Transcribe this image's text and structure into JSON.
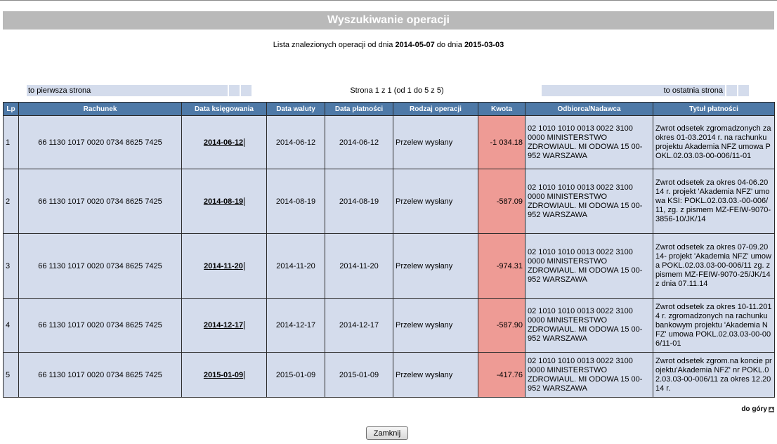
{
  "title": "Wyszukiwanie operacji",
  "subtitle": {
    "prefix": "Lista znalezionych operacji od dnia",
    "date_from": "2014-05-07",
    "middle": "do dnia",
    "date_to": "2015-03-03"
  },
  "pager": {
    "first": "to pierwsza strona",
    "info": "Strona 1 z 1 (od 1 do 5 z 5)",
    "last": "to ostatnia strona"
  },
  "table": {
    "headers": [
      "Lp",
      "Rachunek",
      "Data księgowania",
      "Data waluty",
      "Data płatności",
      "Rodzaj operacji",
      "Kwota",
      "Odbiorca/Nadawca",
      "Tytuł płatności"
    ],
    "rows": [
      {
        "lp": "1",
        "rachunek": "66 1130 1017 0020 0734 8625 7425",
        "data_ksiegowania": "2014-06-12",
        "data_waluty": "2014-06-12",
        "data_platnosci": "2014-06-12",
        "rodzaj": "Przelew wysłany",
        "kwota": "-1 034.18",
        "odbiorca": "02 1010 1010 0013 0022 3100 0000 MINISTERSTWO ZDROWIAUL. MI ODOWA 15 00-952 WARSZAWA",
        "tytul": "Zwrot odsetek zgromadzonych za okres 01-03.2014 r. na rachunku projektu Akademia NFZ umowa POKL.02.03.03-00-006/11-01"
      },
      {
        "lp": "2",
        "rachunek": "66 1130 1017 0020 0734 8625 7425",
        "data_ksiegowania": "2014-08-19",
        "data_waluty": "2014-08-19",
        "data_platnosci": "2014-08-19",
        "rodzaj": "Przelew wysłany",
        "kwota": "-587.09",
        "odbiorca": "02 1010 1010 0013 0022 3100 0000 MINISTERSTWO ZDROWIAUL. MI ODOWA 15 00-952 WARSZAWA",
        "tytul": "Zwrot odsetek za okres 04-06.2014 r. projekt 'Akademia NFZ' umowa KSI: POKL.02.03.03.-00-006/11, zg. z pismem MZ-FEIW-9070-3856-10/JK/14"
      },
      {
        "lp": "3",
        "rachunek": "66 1130 1017 0020 0734 8625 7425",
        "data_ksiegowania": "2014-11-20",
        "data_waluty": "2014-11-20",
        "data_platnosci": "2014-11-20",
        "rodzaj": "Przelew wysłany",
        "kwota": "-974.31",
        "odbiorca": "02 1010 1010 0013 0022 3100 0000 MINISTERSTWO ZDROWIAUL. MI ODOWA 15 00-952 WARSZAWA",
        "tytul": "Zwrot odsetek za okres 07-09.2014- projekt 'Akademia NFZ' umowa POKL.02.03.03-00-006/11 zg. z pismem MZ-FEIW-9070-25/JK/14 z dnia 07.11.14"
      },
      {
        "lp": "4",
        "rachunek": "66 1130 1017 0020 0734 8625 7425",
        "data_ksiegowania": "2014-12-17",
        "data_waluty": "2014-12-17",
        "data_platnosci": "2014-12-17",
        "rodzaj": "Przelew wysłany",
        "kwota": "-587.90",
        "odbiorca": "02 1010 1010 0013 0022 3100 0000 MINISTERSTWO ZDROWIAUL. MI ODOWA 15 00-952 WARSZAWA",
        "tytul": "Zwrot odsetek za okres 10-11.2014 r. zgromadzonych na rachunku bankowym projektu 'Akademia NFZ' umowa POKL.02.03.03-00-006/11-01"
      },
      {
        "lp": "5",
        "rachunek": "66 1130 1017 0020 0734 8625 7425",
        "data_ksiegowania": "2015-01-09",
        "data_waluty": "2015-01-09",
        "data_platnosci": "2015-01-09",
        "rodzaj": "Przelew wysłany",
        "kwota": "-417.76",
        "odbiorca": "02 1010 1010 0013 0022 3100 0000 MINISTERSTWO ZDROWIAUL. MI ODOWA 15 00-952 WARSZAWA",
        "tytul": "Zwrot odsetek zgrom.na koncie projektu'Akademia NFZ' nr POKL.02.03.03-00-006/11 za okres 12.2014 r."
      }
    ]
  },
  "footer": {
    "top_link": "do góry",
    "close_button": "Zamknij"
  },
  "colors": {
    "title_bar": "#b9b9b9",
    "header_bg": "#4e79a7",
    "row_bg": "#d4dcec",
    "amount_bg": "#ee9b95"
  }
}
